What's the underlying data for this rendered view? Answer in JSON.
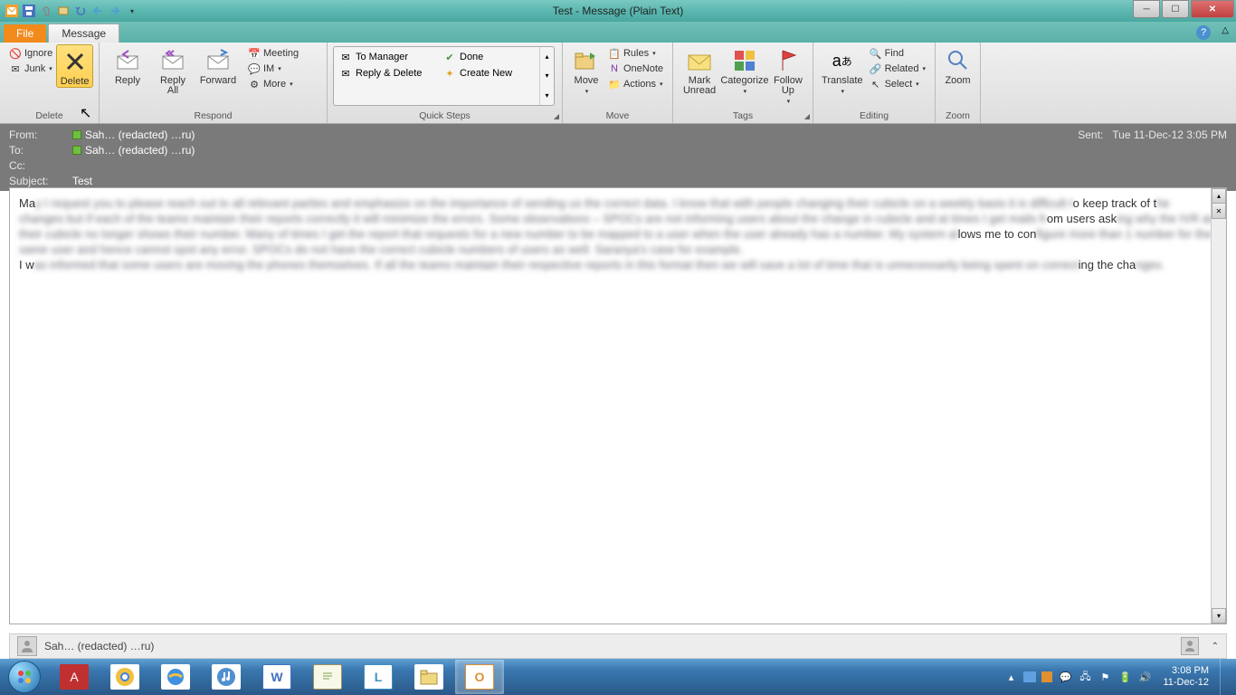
{
  "title": "Test  -  Message (Plain Text)",
  "tabs": {
    "file": "File",
    "message": "Message"
  },
  "ribbon": {
    "delete_group": "Delete",
    "ignore": "Ignore",
    "junk": "Junk",
    "delete": "Delete",
    "respond_group": "Respond",
    "reply": "Reply",
    "reply_all": "Reply\nAll",
    "forward": "Forward",
    "meeting": "Meeting",
    "im": "IM",
    "more": "More",
    "quicksteps_group": "Quick Steps",
    "qs_tomanager": "To Manager",
    "qs_replydelete": "Reply & Delete",
    "qs_done": "Done",
    "qs_createnew": "Create New",
    "move_group": "Move",
    "move": "Move",
    "rules": "Rules",
    "onenote": "OneNote",
    "actions": "Actions",
    "tags_group": "Tags",
    "mark_unread": "Mark\nUnread",
    "categorize": "Categorize",
    "followup": "Follow\nUp",
    "editing_group": "Editing",
    "translate": "Translate",
    "find": "Find",
    "related": "Related",
    "select": "Select",
    "zoom_group": "Zoom",
    "zoom": "Zoom"
  },
  "header": {
    "from_lbl": "From:",
    "to_lbl": "To:",
    "cc_lbl": "Cc:",
    "subject_lbl": "Subject:",
    "from_val": "Sah… (redacted) …ru)",
    "to_val": "Sah… (redacted) …ru)",
    "cc_val": "",
    "subject_val": "Test",
    "sent_lbl": "Sent:",
    "sent_val": "Tue 11-Dec-12 3:05 PM"
  },
  "body": {
    "p1a": "Ma",
    "p1b": "y I request you to please reach out to all relevant parties and emphasize on the importance of sending us the correct data. I know that with people changing their cubicle on a weekly basis it is difficult t",
    "p1c": "o keep track",
    "p2a": "of t",
    "p2b": "he changes but if each of the teams maintain their reports correctly it will minimize the errors. Some observations – SPOCs are not informing users about the change in cubicle and at times I get mails fr",
    "p2c": "om users",
    "p3a": "ask",
    "p3b": "ing why the IVR at their cubicle no longer shows their number. Many of times I get the report that requests for a new number to be mapped to a user when the user already has a number. My system al",
    "p3c": "lows me to",
    "p4a": "con",
    "p4b": "figure more than 1 number for the same user and hence cannot spot any error. SPOCs do not have the correct cubicle numbers of users as well. Saranya's case for example.",
    "p5a": "I w",
    "p5b": "as informed that some users are moving the phones themselves. If all the teams maintain their respective reports in this format then we will save a lot of time that is unnecessarily being spent on correct",
    "p5c": "ing the",
    "p6a": "cha",
    "p6b": "nges."
  },
  "people": {
    "name": "Sah… (redacted) …ru)"
  },
  "taskbar": {
    "time": "3:08 PM",
    "date": "11-Dec-12"
  }
}
